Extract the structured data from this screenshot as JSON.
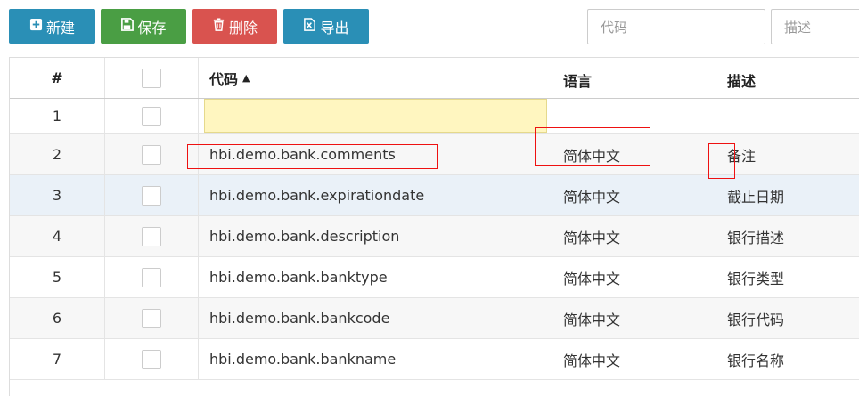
{
  "toolbar": {
    "new_label": "新建",
    "save_label": "保存",
    "delete_label": "删除",
    "export_label": "导出"
  },
  "filters": {
    "code_placeholder": "代码",
    "desc_placeholder": "描述"
  },
  "table": {
    "columns": {
      "num": "#",
      "code": "代码",
      "lang": "语言",
      "desc": "描述"
    },
    "sort_indicator": "▲",
    "rows": [
      {
        "num": "1",
        "code": "",
        "lang": "",
        "desc": ""
      },
      {
        "num": "2",
        "code": "hbi.demo.bank.comments",
        "lang": "简体中文",
        "desc": "备注"
      },
      {
        "num": "3",
        "code": "hbi.demo.bank.expirationdate",
        "lang": "简体中文",
        "desc": "截止日期"
      },
      {
        "num": "4",
        "code": "hbi.demo.bank.description",
        "lang": "简体中文",
        "desc": "银行描述"
      },
      {
        "num": "5",
        "code": "hbi.demo.bank.banktype",
        "lang": "简体中文",
        "desc": "银行类型"
      },
      {
        "num": "6",
        "code": "hbi.demo.bank.bankcode",
        "lang": "简体中文",
        "desc": "银行代码"
      },
      {
        "num": "7",
        "code": "hbi.demo.bank.bankname",
        "lang": "简体中文",
        "desc": "银行名称"
      }
    ]
  },
  "colors": {
    "primary": "#2a8fb6",
    "success": "#4a9e44",
    "danger": "#d9534f",
    "editor_bg": "#fff6c0",
    "selected_row": "#eaf1f8",
    "annotation": "#e11111"
  },
  "icons": [
    "plus-square-icon",
    "floppy-disk-icon",
    "trash-icon",
    "excel-file-icon"
  ]
}
